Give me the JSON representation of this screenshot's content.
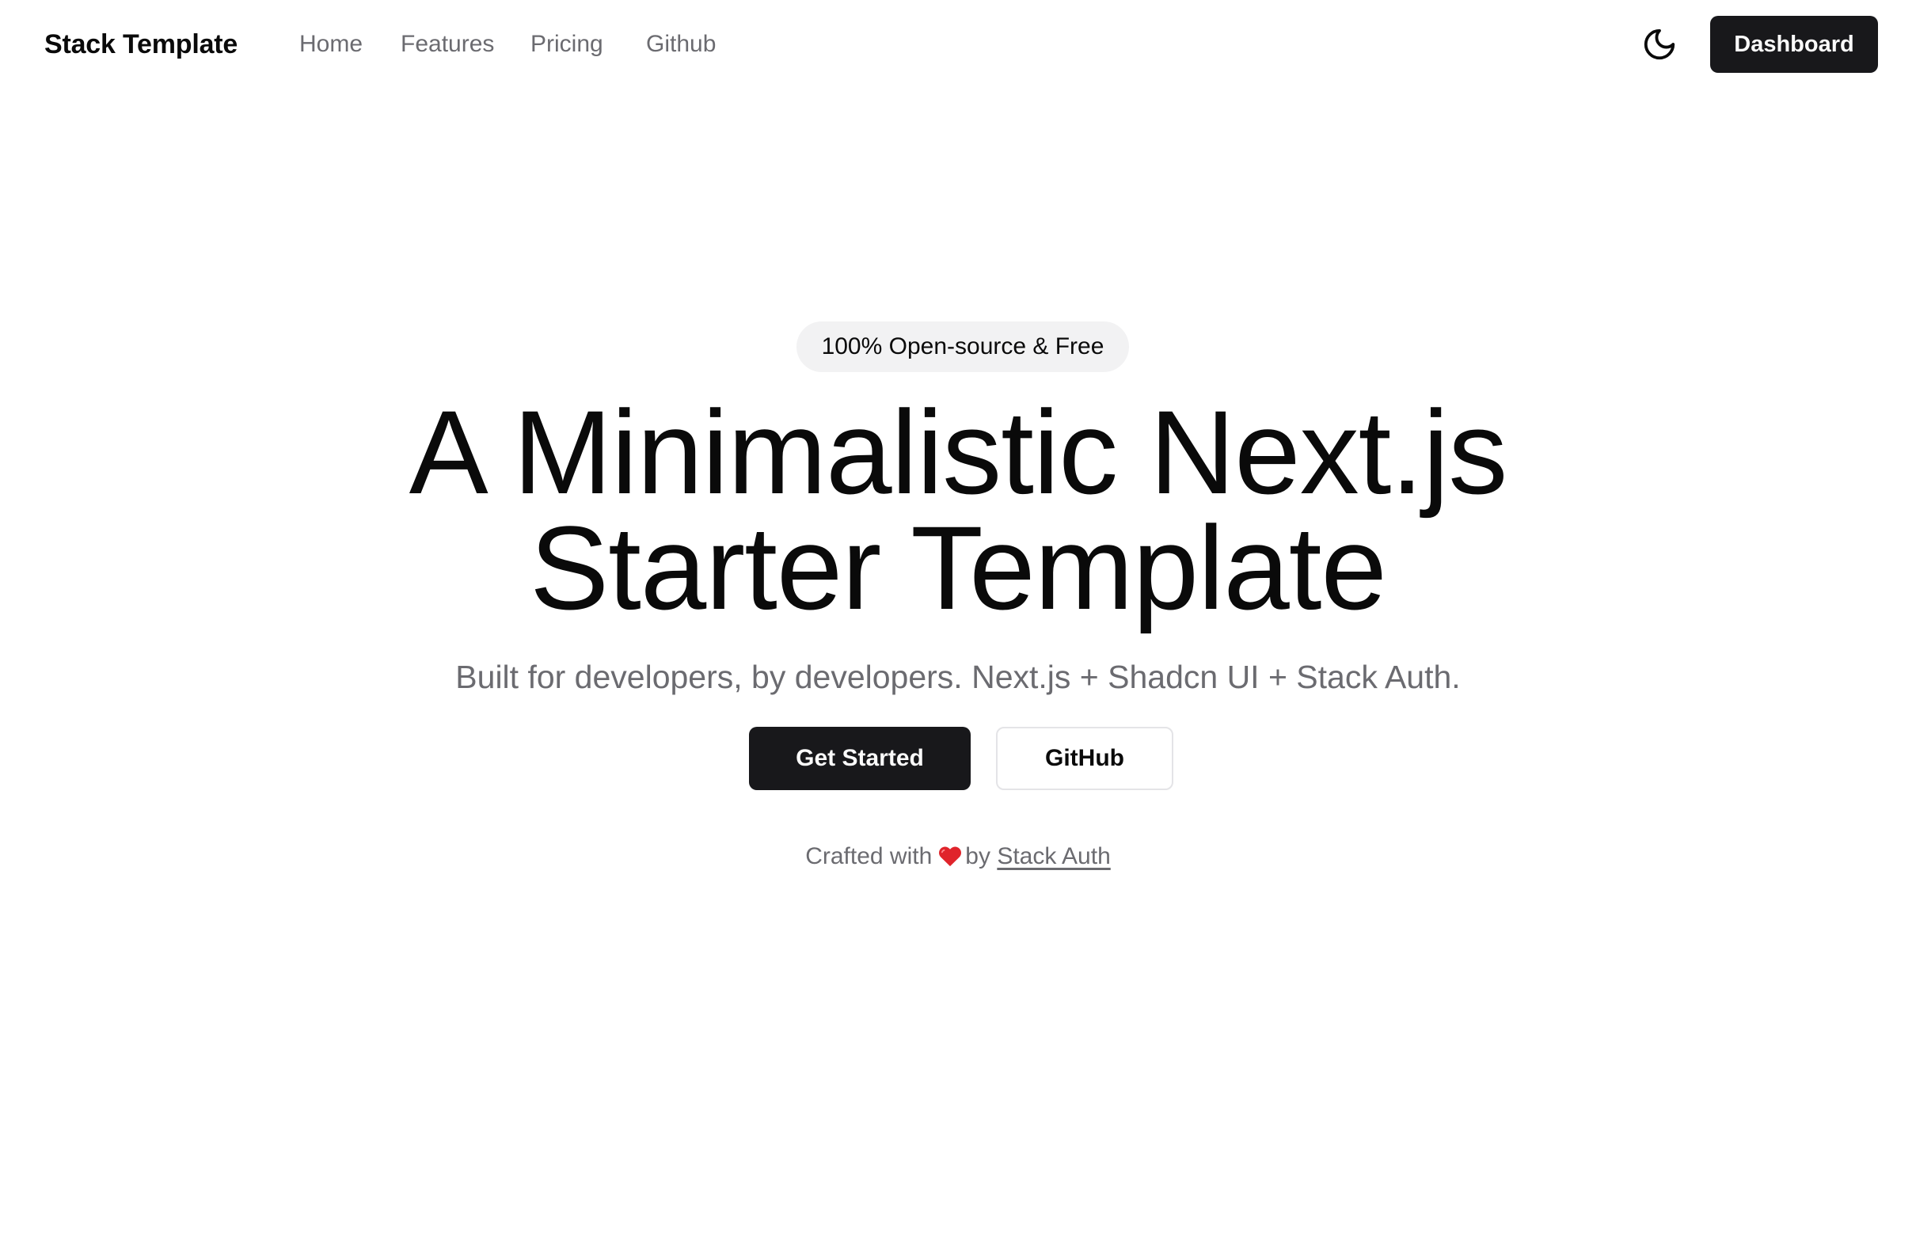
{
  "header": {
    "brand": "Stack Template",
    "nav": [
      {
        "label": "Home"
      },
      {
        "label": "Features"
      },
      {
        "label": "Pricing"
      },
      {
        "label": "Github"
      }
    ],
    "theme_toggle_icon": "moon-icon",
    "dashboard_label": "Dashboard"
  },
  "hero": {
    "badge": "100% Open-source & Free",
    "headline_line1": "A Minimalistic Next.js",
    "headline_line2": "Starter Template",
    "subtitle": "Built for developers, by developers. Next.js + Shadcn UI + Stack Auth.",
    "primary_button": "Get Started",
    "secondary_button": "GitHub",
    "crafted_prefix": "Crafted with",
    "crafted_icon": "heart-icon",
    "crafted_by": "by",
    "crafted_link": "Stack Auth"
  },
  "colors": {
    "primary": "#18181b",
    "muted_text": "#6b6b70",
    "badge_bg": "#f2f2f3",
    "heart": "#e0242b"
  }
}
